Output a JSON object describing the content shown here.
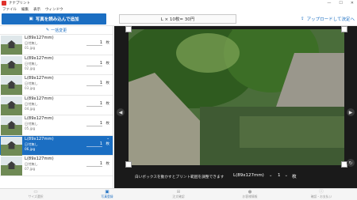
{
  "window": {
    "title": "ナナプリント",
    "controls": [
      "—",
      "☐",
      "✕"
    ]
  },
  "menu": [
    "ファイル",
    "編集",
    "表示",
    "ウィンドウ"
  ],
  "toolbar": {
    "load_button": "写真を読み込んで追加",
    "summary": "L × 10枚= 30円",
    "upload_button": "アップロードして決定へ"
  },
  "sidebar": {
    "bulk_change": "一括変更",
    "items": [
      {
        "size": "L(89x127mm)",
        "option": "日付無し",
        "file": "01.jpg",
        "qty": "1",
        "unit": "枚"
      },
      {
        "size": "L(89x127mm)",
        "option": "日付無し",
        "file": "02.jpg",
        "qty": "1",
        "unit": "枚"
      },
      {
        "size": "L(89x127mm)",
        "option": "日付無し",
        "file": "03.jpg",
        "qty": "1",
        "unit": "枚"
      },
      {
        "size": "L(89x127mm)",
        "option": "日付無し",
        "file": "04.jpg",
        "qty": "1",
        "unit": "枚"
      },
      {
        "size": "L(89x127mm)",
        "option": "日付無し",
        "file": "05.jpg",
        "qty": "1",
        "unit": "枚"
      },
      {
        "size": "L(89x127mm)",
        "option": "日付無し",
        "file": "06.jpg",
        "qty": "1",
        "unit": "枚"
      },
      {
        "size": "L(89x127mm)",
        "option": "日付無し",
        "file": "07.jpg",
        "qty": "1",
        "unit": "枚"
      }
    ]
  },
  "editor": {
    "hint": "白いボックスを動かすとプリント範囲を調整できます",
    "size": "L(89x127mm)",
    "qty": "1",
    "unit": "枚"
  },
  "bottom_tabs": [
    {
      "label": "サイズ選択",
      "icon": "photo-icon"
    },
    {
      "label": "写真登録",
      "icon": "image-icon"
    },
    {
      "label": "注文確認",
      "icon": "cart-icon"
    },
    {
      "label": "お客様情報",
      "icon": "person-icon"
    },
    {
      "label": "確認・お支払い",
      "icon": "info-icon"
    }
  ],
  "colors": {
    "accent": "#1b6ec2",
    "editor_bg": "#1a1a1a"
  }
}
